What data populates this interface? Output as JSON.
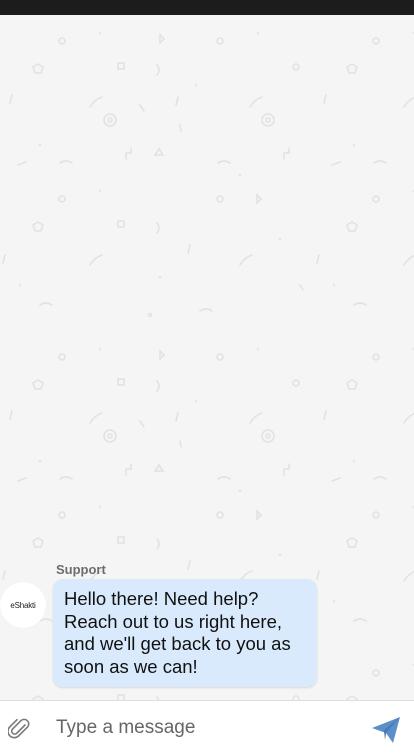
{
  "chat": {
    "messages": [
      {
        "sender": "Support",
        "avatar_text": "eShakti",
        "text": "Hello there! Need help?\nReach out to us right here,\nand we'll get back to you as\nsoon as we can!"
      }
    ]
  },
  "composer": {
    "placeholder": "Type a message",
    "attach_icon": "paperclip-icon",
    "send_icon": "send-icon"
  },
  "colors": {
    "status_bar": "#1c1c1c",
    "background": "#f5f5f6",
    "bubble": "#d9eafc",
    "send_accent": "#5b8fc9"
  }
}
